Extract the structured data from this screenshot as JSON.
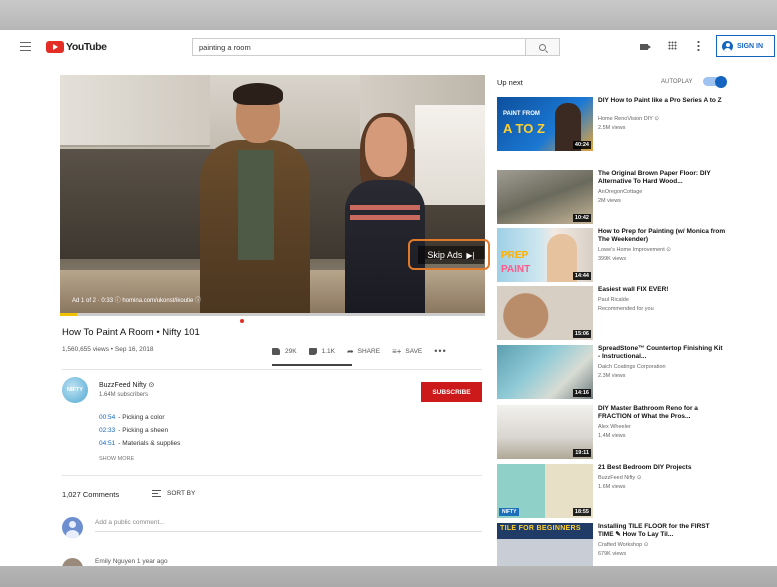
{
  "header": {
    "logo_text": "YouTube",
    "search_value": "painting a room",
    "signin_label": "SIGN IN"
  },
  "player": {
    "ad_info": "Ad 1 of 2 · 0:33 ⓘ homina.com/ukonst/ikoutie ⓘ",
    "skip_label": "Skip Ads",
    "skip_glyph": "▶|"
  },
  "video": {
    "title": "How To Paint A Room • Nifty 101",
    "views": "1,560,655 views • Sep 16, 2018",
    "likes": "29K",
    "dislikes": "1.1K",
    "share_label": "SHARE",
    "save_label": "SAVE",
    "more_label": "•••"
  },
  "channel": {
    "avatar_text": "NIFTY",
    "name": "BuzzFeed Nifty ⊙",
    "subscribers": "1.64M subscribers",
    "subscribe_label": "SUBSCRIBE",
    "chapters": [
      {
        "time": "00:54",
        "label": "- Picking a color"
      },
      {
        "time": "02:33",
        "label": "- Picking a sheen"
      },
      {
        "time": "04:51",
        "label": "- Materials & supplies"
      }
    ],
    "show_more": "SHOW MORE"
  },
  "comments": {
    "count": "1,027 Comments",
    "sort_label": "SORT BY",
    "placeholder": "Add a public comment...",
    "first_author": "Emily Nguyen 1 year ago"
  },
  "sidebar": {
    "up_next": "Up next",
    "autoplay": "AUTOPLAY",
    "autoplay_on": true,
    "items": [
      {
        "title": "DIY How to Paint like a Pro Series A to Z",
        "channel": "Home RenoVision DIY ⊙",
        "views": "2.5M views",
        "duration": "40:24",
        "thumb_text_small": "PAINT FROM",
        "thumb_text_big": "A TO Z"
      },
      {
        "title": "The Original Brown Paper Floor: DIY Alternative To Hard Wood...",
        "channel": "AnOregonCottage",
        "views": "2M views",
        "duration": "10:42"
      },
      {
        "title": "How to Prep for Painting (w/ Monica from The Weekender)",
        "channel": "Lowe's Home Improvement ⊙",
        "views": "399K views",
        "duration": "14:44",
        "thumb_text_big": "PREP",
        "thumb_text_big2": "PAINT"
      },
      {
        "title": "Easiest wall FIX EVER!",
        "channel": "Paul Ricalde",
        "views": "Recommended for you",
        "duration": "15:06"
      },
      {
        "title": "SpreadStone™ Countertop Finishing Kit - Instructional...",
        "channel": "Daich Coatings Corporation",
        "views": "2.3M views",
        "duration": "14:16"
      },
      {
        "title": "DIY Master Bathroom Reno for a FRACTION of What the Pros...",
        "channel": "Alex Wheeler",
        "views": "1.4M views",
        "duration": "19:11"
      },
      {
        "title": "21 Best Bedroom DIY Projects",
        "channel": "BuzzFeed Nifty ⊙",
        "views": "1.6M views",
        "duration": "18:55",
        "thumb_text_small": "NIFTY"
      },
      {
        "title": "Installing TILE FLOOR for the FIRST TIME ✎ How To Lay Til...",
        "channel": "Crafted Workshop ⊙",
        "views": "679K views",
        "thumb_text_big": "TILE FOR BEGINNERS"
      }
    ]
  },
  "colors": {
    "accent": "#1565c0",
    "subscribe": "#cc1a1a",
    "skip_highlight": "#e07a2a"
  }
}
